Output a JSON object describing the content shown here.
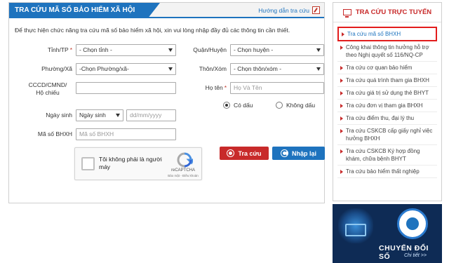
{
  "main": {
    "title": "TRA CỨU MÃ SỐ BẢO HIỂM XÃ HỘI",
    "guide_label": "Hướng dẫn tra cứu",
    "intro": "Để thực hiện chức năng tra cứu mã số bảo hiểm xã hội, xin vui lòng nhập đầy đủ các thông tin cần thiết."
  },
  "form": {
    "province_label": "Tỉnh/TP",
    "province_value": "- Chọn tỉnh -",
    "district_label": "Quận/Huyện",
    "district_value": "- Chọn huyện -",
    "ward_label": "Phường/Xã",
    "ward_value": "-Chọn Phường/xã-",
    "hamlet_label": "Thôn/Xóm",
    "hamlet_value": "- Chọn thôn/xóm -",
    "id_label_line1": "CCCD/CMND/",
    "id_label_line2": "Hộ chiếu",
    "id_value": "",
    "name_label": "Họ tên",
    "name_placeholder": "Họ Và Tên",
    "accent_yes": "Có dấu",
    "accent_no": "Không dấu",
    "dob_label": "Ngày sinh",
    "dob_type_value": "Ngày sinh",
    "dob_placeholder": "dd/mm/yyyy",
    "bhxh_label": "Mã số BHXH",
    "bhxh_placeholder": "Mã số BHXH",
    "required_mark": "*"
  },
  "captcha": {
    "text": "Tôi không phải là người máy",
    "brand": "reCAPTCHA",
    "terms": "Bảo mật - Điều khoản"
  },
  "buttons": {
    "search": "Tra cứu",
    "reset": "Nhập lại"
  },
  "sidebar": {
    "title": "TRA CỨU TRỰC TUYẾN",
    "items": [
      "Tra cứu mã số BHXH",
      "Công khai thông tin hưởng hỗ trợ theo Nghị quyết số 116/NQ-CP",
      "Tra cứu cơ quan bảo hiểm",
      "Tra cứu quá trình tham gia BHXH",
      "Tra cứu giá trị sử dụng thẻ BHYT",
      "Tra cứu đơn vị tham gia BHXH",
      "Tra cứu điểm thu, đại lý thu",
      "Tra cứu CSKCB cấp giấy nghỉ việc hưởng BHXH",
      "Tra cứu CSKCB Ký hợp đồng khám, chữa bệnh BHYT",
      "Tra cứu bảo hiểm thất nghiệp"
    ]
  },
  "banner": {
    "text": "CHUYỂN ĐỔI SỐ",
    "sub": "Chi tiết >>"
  },
  "colors": {
    "primary": "#1e73be",
    "danger": "#c82a2a",
    "highlight_border": "#e21c1c"
  }
}
